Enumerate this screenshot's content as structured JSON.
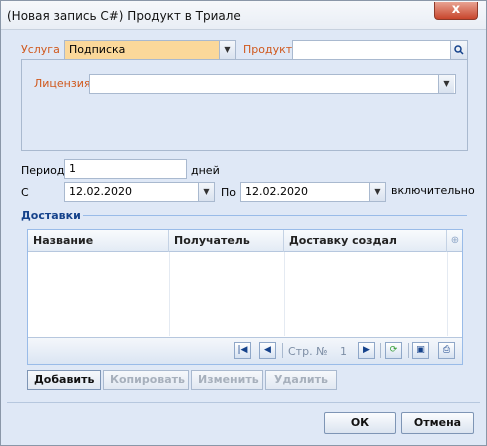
{
  "window": {
    "title": "(Новая запись C#) Продукт в Триале",
    "close_glyph": "x"
  },
  "form": {
    "service_label": "Услуга",
    "service_value": "Подписка",
    "product_label": "Продукт",
    "product_value": "",
    "license_label": "Лицензия",
    "license_value": "",
    "period_label": "Период",
    "period_value": "1",
    "period_unit": "дней",
    "from_label": "С",
    "from_date": "12.02.2020",
    "to_label": "По",
    "to_date": "12.02.2020",
    "inclusive_label": "включительно"
  },
  "deliveries": {
    "section_title": "Доставки",
    "columns": [
      "Название",
      "Получатель",
      "Доставку создал"
    ],
    "rows": [],
    "pager": {
      "page_label": "Стр. №",
      "page_number": "1"
    },
    "buttons": {
      "add": "Добавить",
      "copy": "Копировать",
      "edit": "Изменить",
      "delete": "Удалить"
    }
  },
  "footer": {
    "ok": "ОК",
    "cancel": "Отмена"
  },
  "icons": [
    "close-icon",
    "dropdown-arrow-icon",
    "search-icon",
    "first-page-icon",
    "prev-page-icon",
    "next-page-icon",
    "refresh-icon",
    "save-icon",
    "print-icon",
    "column-settings-icon"
  ],
  "colors": {
    "background": "#dfe8f6",
    "label_accent": "#d0581c",
    "section_title": "#15428b",
    "highlight_field": "#fbd89a"
  }
}
